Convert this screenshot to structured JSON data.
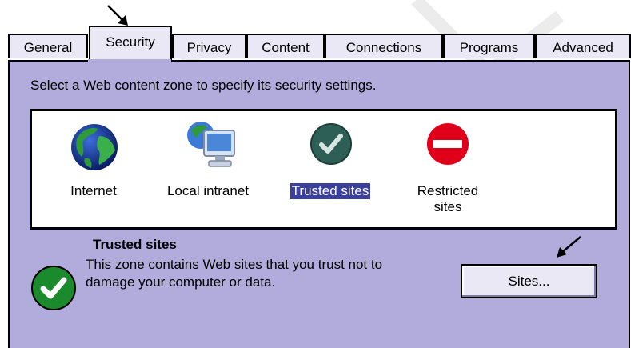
{
  "tabs": [
    {
      "label": "General"
    },
    {
      "label": "Security"
    },
    {
      "label": "Privacy"
    },
    {
      "label": "Content"
    },
    {
      "label": "Connections"
    },
    {
      "label": "Programs"
    },
    {
      "label": "Advanced"
    }
  ],
  "instruction": "Select a Web content zone to specify its security settings.",
  "zones": [
    {
      "label": "Internet",
      "icon": "globe-icon"
    },
    {
      "label": "Local intranet",
      "icon": "computer-globe-icon"
    },
    {
      "label": "Trusted sites",
      "icon": "checkmark-icon",
      "selected": true
    },
    {
      "label_line1": "Restricted",
      "label_line2": "sites",
      "icon": "no-entry-icon"
    }
  ],
  "detail": {
    "title": "Trusted sites",
    "description": "This zone contains Web sites that you trust not to damage your computer or data.",
    "icon": "checkmark-icon"
  },
  "sites_button": "Sites...",
  "colors": {
    "panel": "#b2acdc",
    "tab": "#ebe8f6",
    "selection": "#3b3f9e",
    "trusted_green": "#2a6b46",
    "restricted_red": "#e0001a"
  }
}
